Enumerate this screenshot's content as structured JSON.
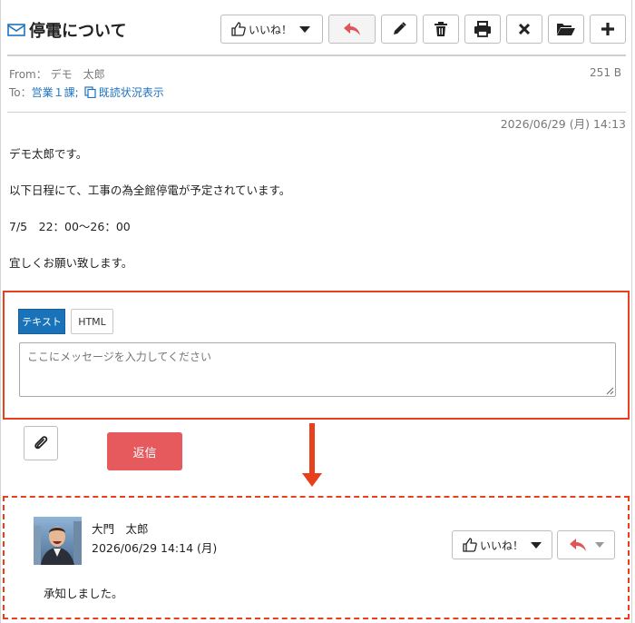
{
  "message": {
    "title": "停電について",
    "toolbar": {
      "like_label": "いいね！"
    },
    "from_label": "From：",
    "from_name": "デモ　太郎",
    "size": "251 B",
    "to_label": "To：",
    "to_recipient": "営業１課;",
    "read_status_link": "既読状況表示",
    "date": "2026/06/29 (月) 14:13",
    "body": [
      "デモ太郎です。",
      "以下日程にて、工事の為全館停電が予定されています。",
      "7/5　22：00～26：00",
      "宜しくお願い致します。"
    ]
  },
  "reply_form": {
    "tab_text": "テキスト",
    "tab_html": "HTML",
    "placeholder": "ここにメッセージを入力してください",
    "send_label": "返信"
  },
  "comment": {
    "author": "大門　太郎",
    "date": "2026/06/29 14:14 (月)",
    "like_label": "いいね！",
    "text": "承知しました。"
  },
  "colors": {
    "accent_red": "#e8401c",
    "send_button": "#e6595c",
    "tab_active": "#1a73b8",
    "link": "#1e73be",
    "reply_icon": "#e0555a"
  }
}
